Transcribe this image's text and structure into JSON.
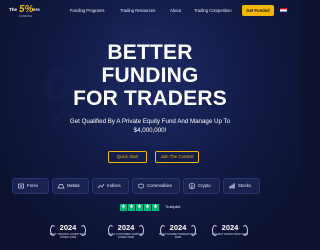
{
  "brand": {
    "logo_the": "The",
    "logo_five": "5%",
    "logo_ers": "ers",
    "logo_sub": "FUNDING"
  },
  "nav": {
    "links": [
      "Funding Programs",
      "Trading Resources",
      "About",
      "Trading Competition"
    ],
    "cta": "Get Funded",
    "language_flag": "uk-flag-icon"
  },
  "hero": {
    "title_lines": [
      "BETTER",
      "FUNDING",
      "FOR TRADERS"
    ],
    "subtitle": "Get Qualified By A Private Equity Fund And Manage Up To $4,000,000!",
    "buttons": [
      "Quick Start",
      "Join The Contest"
    ]
  },
  "categories": [
    {
      "label": "Forex",
      "icon": "forex-icon"
    },
    {
      "label": "Metals",
      "icon": "metals-icon"
    },
    {
      "label": "Indices",
      "icon": "indices-icon"
    },
    {
      "label": "Commodities",
      "icon": "commodities-icon"
    },
    {
      "label": "Crypto",
      "icon": "crypto-icon"
    },
    {
      "label": "Stocks",
      "icon": "stocks-icon"
    }
  ],
  "trustpilot": {
    "label": "Trustpilot",
    "stars": 5
  },
  "awards": [
    {
      "year": "2024",
      "text": "BEST TRADING CONDITIONS FOREX FIRM"
    },
    {
      "year": "2024",
      "text": "BEST CUSTOMER SUPPORT FOREX FIRM"
    },
    {
      "year": "2024",
      "text": "BEST FUNDED TRADER PROP FIRM"
    },
    {
      "year": "2024",
      "text": "HIGHEST RATED PROP FIRM"
    }
  ],
  "colors": {
    "background": "#0c1230",
    "accent": "#f2b705",
    "trustpilot_green": "#00b67a"
  }
}
